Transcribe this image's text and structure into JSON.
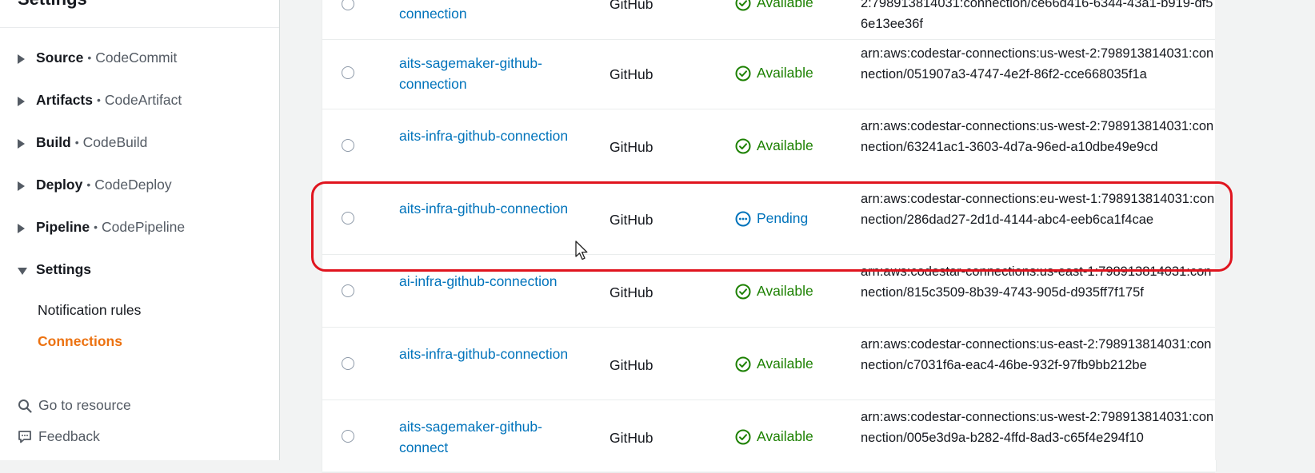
{
  "sidebar": {
    "title": "Settings",
    "sections": [
      {
        "name": "Source",
        "service": "CodeCommit",
        "expanded": false
      },
      {
        "name": "Artifacts",
        "service": "CodeArtifact",
        "expanded": false
      },
      {
        "name": "Build",
        "service": "CodeBuild",
        "expanded": false
      },
      {
        "name": "Deploy",
        "service": "CodeDeploy",
        "expanded": false
      },
      {
        "name": "Pipeline",
        "service": "CodePipeline",
        "expanded": false
      },
      {
        "name": "Settings",
        "service": "",
        "expanded": true
      }
    ],
    "separator": "•",
    "settings_items": [
      "Notification rules",
      "Connections"
    ],
    "active_item": "Connections",
    "go_to_resource": "Go to resource",
    "feedback": "Feedback"
  },
  "connections": {
    "rows": [
      {
        "name": "connection",
        "provider": "GitHub",
        "status": "Available",
        "arn": "2:798913814031:connection/ce66d416-6344-43a1-b919-df56e13ee36f"
      },
      {
        "name": "aits-sagemaker-github-connection",
        "provider": "GitHub",
        "status": "Available",
        "arn": "arn:aws:codestar-connections:us-west-2:798913814031:connection/051907a3-4747-4e2f-86f2-cce668035f1a"
      },
      {
        "name": "aits-infra-github-connection",
        "provider": "GitHub",
        "status": "Available",
        "arn": "arn:aws:codestar-connections:us-west-2:798913814031:connection/63241ac1-3603-4d7a-96ed-a10dbe49e9cd"
      },
      {
        "name": "aits-infra-github-connection",
        "provider": "GitHub",
        "status": "Pending",
        "arn": "arn:aws:codestar-connections:eu-west-1:798913814031:connection/286dad27-2d1d-4144-abc4-eeb6ca1f4cae"
      },
      {
        "name": "ai-infra-github-connection",
        "provider": "GitHub",
        "status": "Available",
        "arn": "arn:aws:codestar-connections:us-east-1:798913814031:connection/815c3509-8b39-4743-905d-d935ff7f175f"
      },
      {
        "name": "aits-infra-github-connection",
        "provider": "GitHub",
        "status": "Available",
        "arn": "arn:aws:codestar-connections:us-east-2:798913814031:connection/c7031f6a-eac4-46be-932f-97fb9bb212be"
      },
      {
        "name": "aits-sagemaker-github-connect",
        "provider": "GitHub",
        "status": "Available",
        "arn": "arn:aws:codestar-connections:us-west-2:798913814031:connection/005e3d9a-b282-4ffd-8ad3-c65f4e294f10"
      }
    ]
  },
  "colors": {
    "link": "#0073bb",
    "available": "#1d8102",
    "pending": "#0073bb",
    "active_nav": "#ec7211",
    "highlight": "#e0141e"
  },
  "icons": {
    "available": "check-circle-icon",
    "pending": "ellipsis-circle-icon",
    "go_to_resource": "search-icon",
    "feedback": "feedback-icon"
  }
}
